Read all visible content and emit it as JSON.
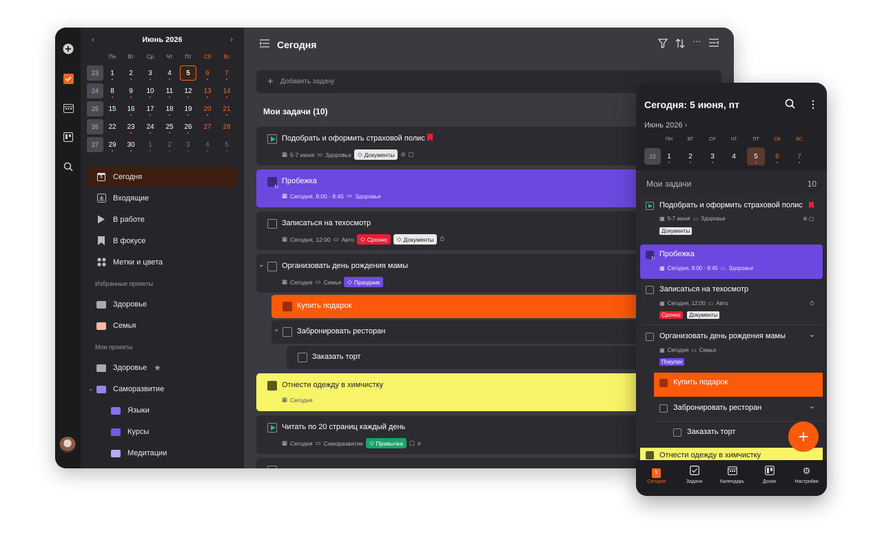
{
  "desktop": {
    "calendar": {
      "month": "Июнь 2026",
      "prev": "‹",
      "next": "›",
      "weekdays": [
        "Пн",
        "Вт",
        "Ср",
        "Чт",
        "Пт",
        "Сб",
        "Вс"
      ],
      "weeks": [
        {
          "num": "23",
          "days": [
            "1",
            "2",
            "3",
            "4",
            "5",
            "6",
            "7"
          ]
        },
        {
          "num": "24",
          "days": [
            "8",
            "9",
            "10",
            "11",
            "12",
            "13",
            "14"
          ]
        },
        {
          "num": "25",
          "days": [
            "15",
            "16",
            "17",
            "18",
            "19",
            "20",
            "21"
          ]
        },
        {
          "num": "26",
          "days": [
            "22",
            "23",
            "24",
            "25",
            "26",
            "27",
            "28"
          ]
        },
        {
          "num": "27",
          "days": [
            "29",
            "30",
            "1",
            "2",
            "3",
            "4",
            "5"
          ]
        }
      ]
    },
    "nav": {
      "today": "Сегодня",
      "today_day": "5",
      "inbox": "Входящие",
      "in_progress": "В работе",
      "focus": "В фокусе",
      "tags": "Метки и цвета"
    },
    "favorites_label": "Избранные проекты",
    "favorites": [
      "Здоровье",
      "Семья"
    ],
    "projects_label": "Мои проекты",
    "projects": [
      "Здоровье",
      "Саморазвитие",
      "Языки",
      "Курсы",
      "Медитации"
    ],
    "header": {
      "title": "Сегодня"
    },
    "add_task": "Добавить задачу",
    "section": "Мои задачи (10)",
    "tasks": [
      {
        "title": "Подобрать и оформить страховой полис",
        "date": "5-7 июня",
        "project": "Здоровье",
        "tag": "Документы"
      },
      {
        "title": "Пробежка",
        "date": "Сегодня, 8:00 - 8:45",
        "project": "Здоровье"
      },
      {
        "title": "Записаться на техосмотр",
        "date": "Сегодня, 12:00",
        "project": "Авто",
        "tag1": "Срочно",
        "tag2": "Документы"
      },
      {
        "title": "Организовать день рождения мамы",
        "date": "Сегодня",
        "project": "Семья",
        "tag": "Праздник"
      },
      {
        "title": "Купить подарок"
      },
      {
        "title": "Забронировать ресторан"
      },
      {
        "title": "Заказать торт"
      },
      {
        "title": "Отнести одежду в химчистку",
        "date": "Сегодня"
      },
      {
        "title": "Читать по 20 страниц каждый день",
        "date": "Сегодня",
        "project": "Саморазвитие",
        "tag": "Привычка"
      }
    ]
  },
  "mobile": {
    "title": "Сегодня: 5 июня, пт",
    "month": "Июнь 2026",
    "weekdays": [
      "ПН",
      "ВТ",
      "СР",
      "ЧТ",
      "ПТ",
      "СБ",
      "ВС"
    ],
    "week_num": "23",
    "days": [
      "1",
      "2",
      "3",
      "4",
      "5",
      "6",
      "7"
    ],
    "section": "Мои задачи",
    "count": "10",
    "tasks": [
      {
        "title": "Подобрать и оформить страховой полис",
        "date": "5-7 июня",
        "project": "Здоровье",
        "tag": "Документы"
      },
      {
        "title": "Пробежка",
        "date": "Сегодня, 8:00 - 8:45",
        "project": "Здоровье"
      },
      {
        "title": "Записаться на техосмотр",
        "date": "Сегодня, 12:00",
        "project": "Авто",
        "tag1": "Срочно",
        "tag2": "Документы"
      },
      {
        "title": "Организовать день рождения мамы",
        "date": "Сегодня",
        "project": "Семья",
        "tag": "Покупки"
      },
      {
        "title": "Купить подарок"
      },
      {
        "title": "Забронировать ресторан"
      },
      {
        "title": "Заказать торт"
      },
      {
        "title": "Отнести одежду в химчистку"
      }
    ],
    "nav": {
      "today": "Сегодня",
      "today_day": "5",
      "tasks": "Задачи",
      "calendar": "Календарь",
      "boards": "Доски",
      "settings": "Настройки"
    },
    "fab": "+"
  },
  "colors": {
    "accent": "#f0661f",
    "purple": "#6c48e0",
    "orange": "#fb5a0a",
    "yellow": "#f8f468"
  }
}
